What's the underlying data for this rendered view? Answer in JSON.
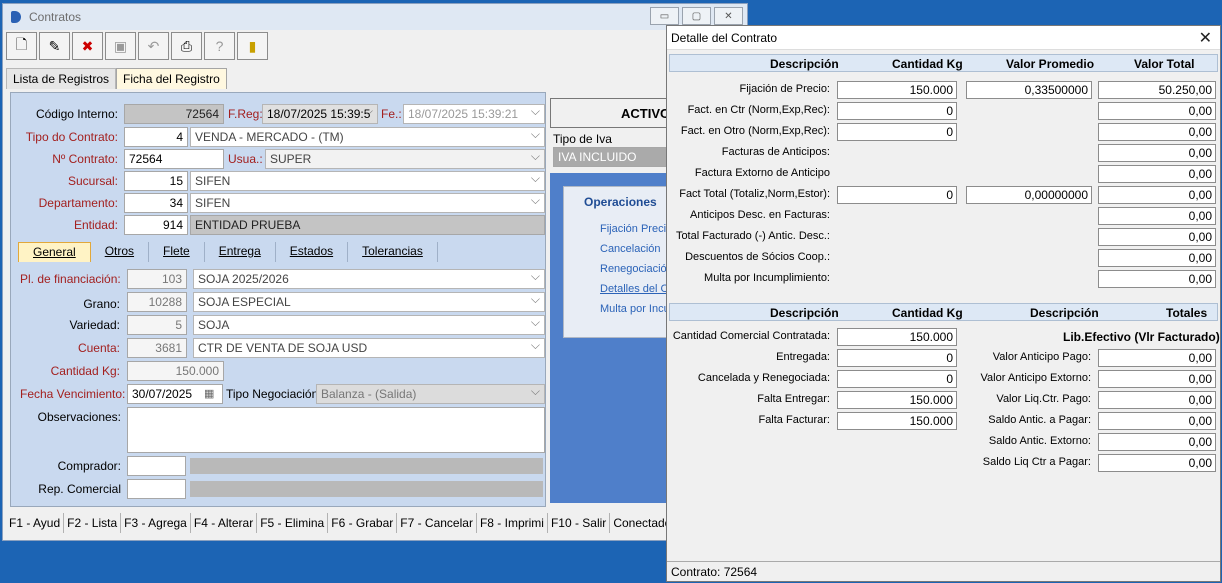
{
  "main_window": {
    "title": "Contratos"
  },
  "toolbar": {
    "icons": [
      "new-document-icon",
      "edit-document-icon",
      "delete-document-icon",
      "save-icon",
      "undo-icon",
      "print-icon",
      "help-icon",
      "exit-icon"
    ],
    "help": "?"
  },
  "tabs": [
    "Lista de Registros",
    "Ficha del Registro"
  ],
  "form": {
    "codigo_label": "Código Interno:",
    "codigo": "72564",
    "freg_label": "F.Reg:",
    "freg": "18/07/2025 15:39:5",
    "fe_label": "Fe.:",
    "fe": "18/07/2025 15:39:21",
    "tipo_label": "Tipo do Contrato:",
    "tipo_code": "4",
    "tipo": "VENDA - MERCADO - (TM)",
    "nro_label": "Nº Contrato:",
    "nro": "72564",
    "usua_label": "Usua.:",
    "usua": "SUPER",
    "sucursal_label": "Sucursal:",
    "sucursal_code": "15",
    "sucursal": "SIFEN",
    "depto_label": "Departamento:",
    "depto_code": "34",
    "depto": "SIFEN",
    "entidad_label": "Entidad:",
    "entidad_code": "914",
    "entidad": "ENTIDAD PRUEBA",
    "estado": "ACTIVO",
    "tipo_iva_label": "Tipo de Iva",
    "tipo_iva": "IVA INCLUIDO"
  },
  "inner_tabs": [
    "General",
    "Otros",
    "Flete",
    "Entrega",
    "Estados",
    "Tolerancias"
  ],
  "general": {
    "plan_label": "Pl. de financiación:",
    "plan_code": "103",
    "plan": "SOJA 2025/2026",
    "grano_label": "Grano:",
    "grano_code": "10288",
    "grano": "SOJA ESPECIAL",
    "variedad_label": "Variedad:",
    "variedad_code": "5",
    "variedad": "SOJA",
    "cuenta_label": "Cuenta:",
    "cuenta_code": "3681",
    "cuenta": "CTR DE VENTA DE SOJA USD",
    "cantidad_label": "Cantidad Kg:",
    "cantidad": "150.000",
    "venc_label": "Fecha Vencimiento:",
    "venc": "30/07/2025",
    "negociacion_label": "Tipo Negociación:",
    "negociacion": "Balanza - (Salida)",
    "obs_label": "Observaciones:",
    "comprador_label": "Comprador:",
    "rep_label": "Rep. Comercial"
  },
  "operaciones": {
    "title": "Operaciones",
    "items": [
      "Fijación Precio",
      "Cancelación",
      "Renegociación",
      "Detalles del C",
      "Multa por Incu"
    ]
  },
  "status_bar": [
    "F1 - Ayud",
    "F2 - Lista",
    "F3 - Agrega",
    "F4 - Alterar",
    "F5 - Elimina",
    "F6 - Grabar",
    "F7 - Cancelar",
    "F8 - Imprimi",
    "F10 - Salir",
    "Conectado"
  ],
  "detail": {
    "title": "Detalle del Contrato",
    "head1": {
      "desc": "Descripción",
      "cant": "Cantidad Kg",
      "prom": "Valor Promedio",
      "total": "Valor Total"
    },
    "rows1": [
      {
        "label": "Fijación de Precio:",
        "cant": "150.000",
        "prom": "0,33500000",
        "total": "50.250,00"
      },
      {
        "label": "Fact. en Ctr (Norm,Exp,Rec):",
        "cant": "0",
        "total": "0,00"
      },
      {
        "label": "Fact. en Otro (Norm,Exp,Rec):",
        "cant": "0",
        "total": "0,00"
      },
      {
        "label": "Facturas de Anticipos:",
        "total": "0,00"
      },
      {
        "label": "Factura Extorno de Anticipo",
        "total": "0,00"
      },
      {
        "label": "Fact Total (Totaliz,Norm,Estor):",
        "cant": "0",
        "prom": "0,00000000",
        "total": "0,00"
      },
      {
        "label": "Anticipos Desc. en Facturas:",
        "total": "0,00"
      },
      {
        "label": "Total Facturado (-) Antic. Desc.:",
        "total": "0,00"
      },
      {
        "label": "Descuentos de Sócios Coop.:",
        "total": "0,00"
      },
      {
        "label": "Multa por Incumplimiento:",
        "total": "0,00"
      }
    ],
    "head2": {
      "desc": "Descripción",
      "cant": "Cantidad Kg",
      "desc2": "Descripción",
      "tot": "Totales"
    },
    "lib_title": "Lib.Efectivo (Vlr Facturado)",
    "rows2": [
      {
        "label": "Cantidad Comercial Contratada:",
        "cant": "150.000"
      },
      {
        "label": "Entregada:",
        "cant": "0"
      },
      {
        "label": "Cancelada y Renegociada:",
        "cant": "0"
      },
      {
        "label": "Falta Entregar:",
        "cant": "150.000"
      },
      {
        "label": "Falta Facturar:",
        "cant": "150.000"
      }
    ],
    "rows3": [
      {
        "label": "Valor Anticipo Pago:",
        "val": "0,00"
      },
      {
        "label": "Valor Anticipo Extorno:",
        "val": "0,00"
      },
      {
        "label": "Valor Liq.Ctr. Pago:",
        "val": "0,00"
      },
      {
        "label": "Saldo Antic. a Pagar:",
        "val": "0,00"
      },
      {
        "label": "Saldo Antic. Extorno:",
        "val": "0,00"
      },
      {
        "label": "Saldo Liq Ctr a Pagar:",
        "val": "0,00"
      }
    ],
    "footer": "Contrato: 72564"
  }
}
